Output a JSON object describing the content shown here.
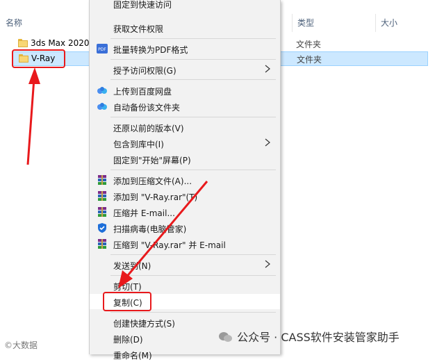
{
  "header": {
    "name_col": "名称",
    "type_col": "类型",
    "size_col": "大小"
  },
  "files": [
    {
      "name": "3ds Max 2020",
      "type": "文件夹"
    },
    {
      "name": "V-Ray",
      "type": "文件夹"
    }
  ],
  "menu": {
    "top_cut": "固定到快速访问",
    "get_permission": "获取文件权限",
    "pdf_convert": "批量转换为PDF格式",
    "grant_access": "授予访问权限(G)",
    "upload_baidu": "上传到百度网盘",
    "auto_backup": "自动备份该文件夹",
    "restore_versions": "还原以前的版本(V)",
    "include_library": "包含到库中(I)",
    "pin_start": "固定到\"开始\"屏幕(P)",
    "add_archive": "添加到压缩文件(A)...",
    "add_vray_rar": "添加到 \"V-Ray.rar\"(T)",
    "compress_email": "压缩并 E-mail...",
    "scan_virus": "扫描病毒(电脑管家)",
    "compress_vray_email": "压缩到 \"V-Ray.rar\" 并 E-mail",
    "send_to": "发送到(N)",
    "cut": "剪切(T)",
    "copy": "复制(C)",
    "create_shortcut": "创建快捷方式(S)",
    "delete": "删除(D)",
    "rename": "重命名(M)"
  },
  "watermark": {
    "main": "公众号 · CASS软件安装管家助手",
    "small": "©大数据"
  },
  "colors": {
    "accent_red": "#e8191c",
    "selection": "#cce8ff",
    "menu_bg": "#f2f2f2"
  }
}
